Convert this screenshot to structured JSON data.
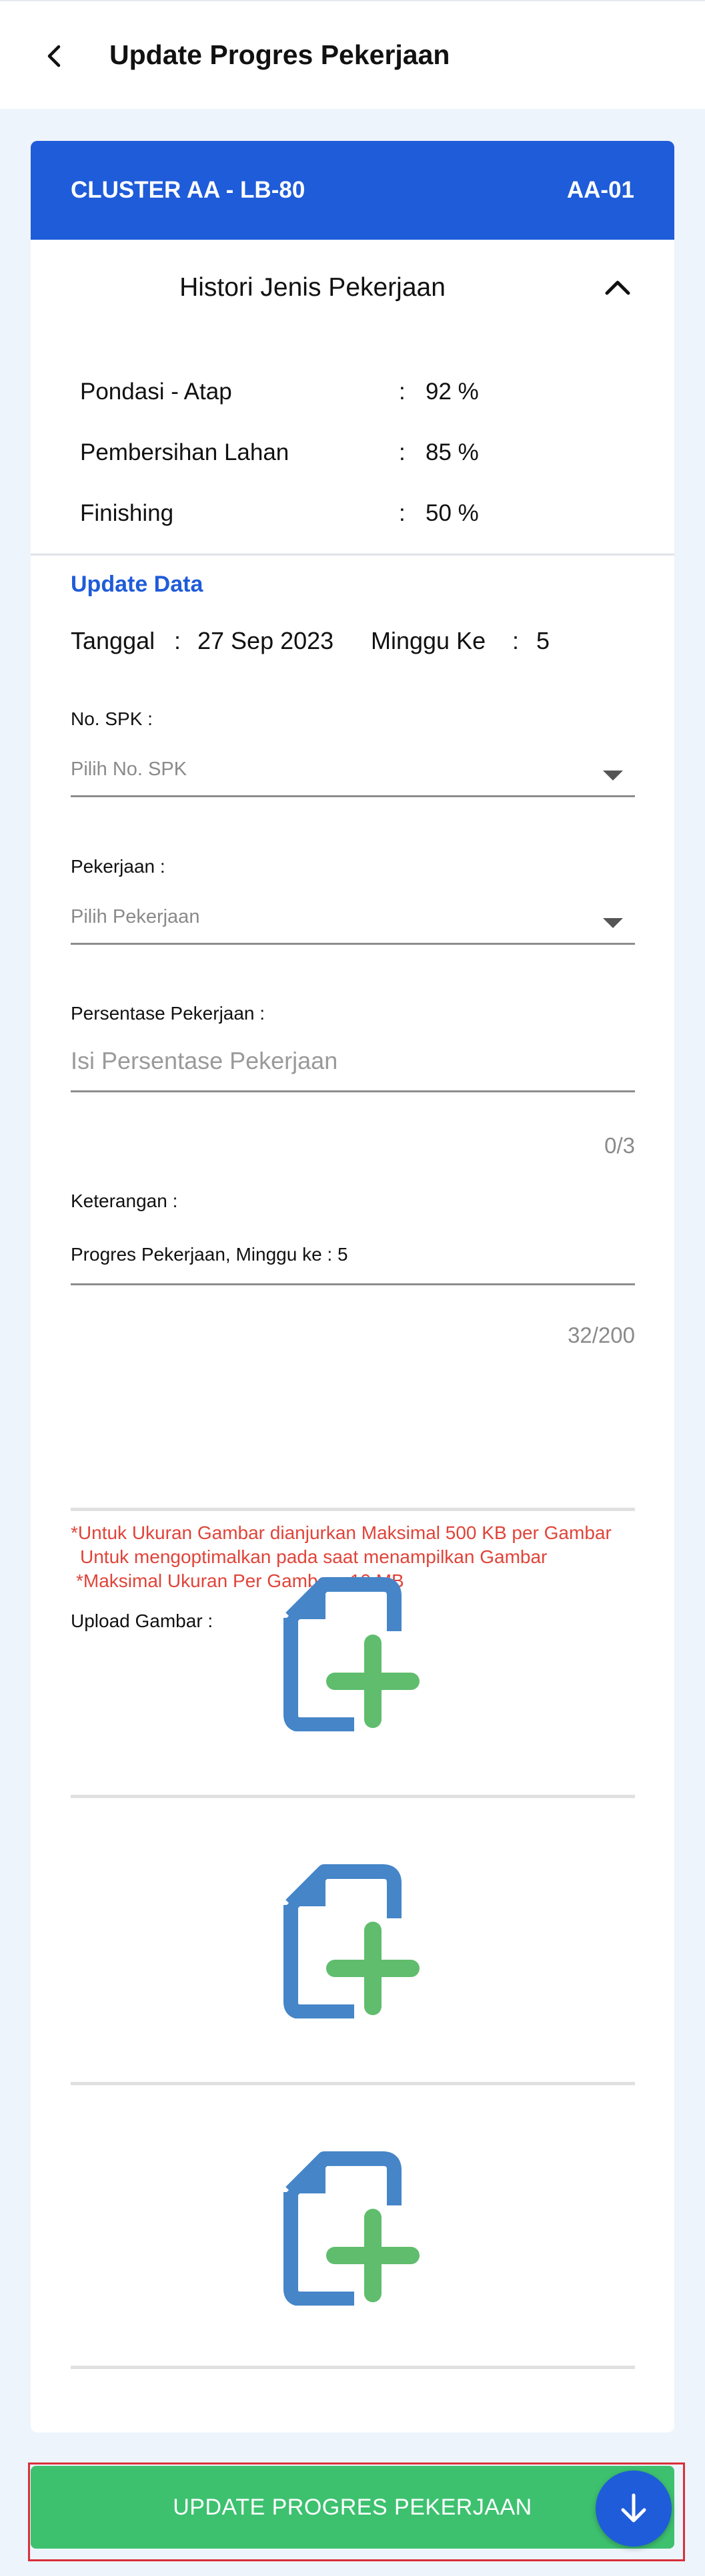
{
  "appbar": {
    "title": "Update Progres Pekerjaan",
    "back_icon": "back-arrow-icon"
  },
  "card": {
    "cluster": "CLUSTER AA - LB-80",
    "unit": "AA-01",
    "header_color": "#1f5cd9"
  },
  "histori": {
    "title": "Histori Jenis Pekerjaan",
    "toggle_icon": "chevron-up-icon",
    "items": [
      {
        "label": "Pondasi - Atap",
        "colon": ":",
        "value": "92 %"
      },
      {
        "label": "Pembersihan Lahan",
        "colon": ":",
        "value": "85 %"
      },
      {
        "label": "Finishing",
        "colon": ":",
        "value": "50 %"
      }
    ]
  },
  "update": {
    "title": "Update Data",
    "tanggal_label": "Tanggal",
    "tanggal_colon": ":",
    "tanggal_value": "27 Sep 2023",
    "minggu_label": "Minggu Ke",
    "minggu_colon": ":",
    "minggu_value": "5"
  },
  "form": {
    "spk_label": "No. SPK :",
    "spk_placeholder": "Pilih No. SPK",
    "pekerjaan_label": "Pekerjaan :",
    "pekerjaan_placeholder": "Pilih Pekerjaan",
    "persentase_label": "Persentase Pekerjaan :",
    "persentase_placeholder": "Isi Persentase Pekerjaan",
    "persentase_counter": "0/3",
    "keterangan_label": "Keterangan :",
    "keterangan_value": "Progres Pekerjaan, Minggu ke : 5",
    "keterangan_counter": "32/200"
  },
  "warning": {
    "line1": "*Untuk Ukuran Gambar dianjurkan Maksimal 500 KB per Gambar",
    "line2": "Untuk mengoptimalkan pada saat menampilkan Gambar",
    "line3": "*Maksimal Ukuran Per Gambar : 10 MB",
    "color": "#e0443a"
  },
  "upload": {
    "label": "Upload Gambar :",
    "slots": [
      {
        "icon": "add-file-icon"
      },
      {
        "icon": "add-file-icon"
      },
      {
        "icon": "add-file-icon"
      }
    ]
  },
  "submit": {
    "label": "UPDATE PROGRES PEKERJAAN",
    "color": "#3dc16f"
  },
  "fab": {
    "icon": "arrow-down-icon"
  }
}
